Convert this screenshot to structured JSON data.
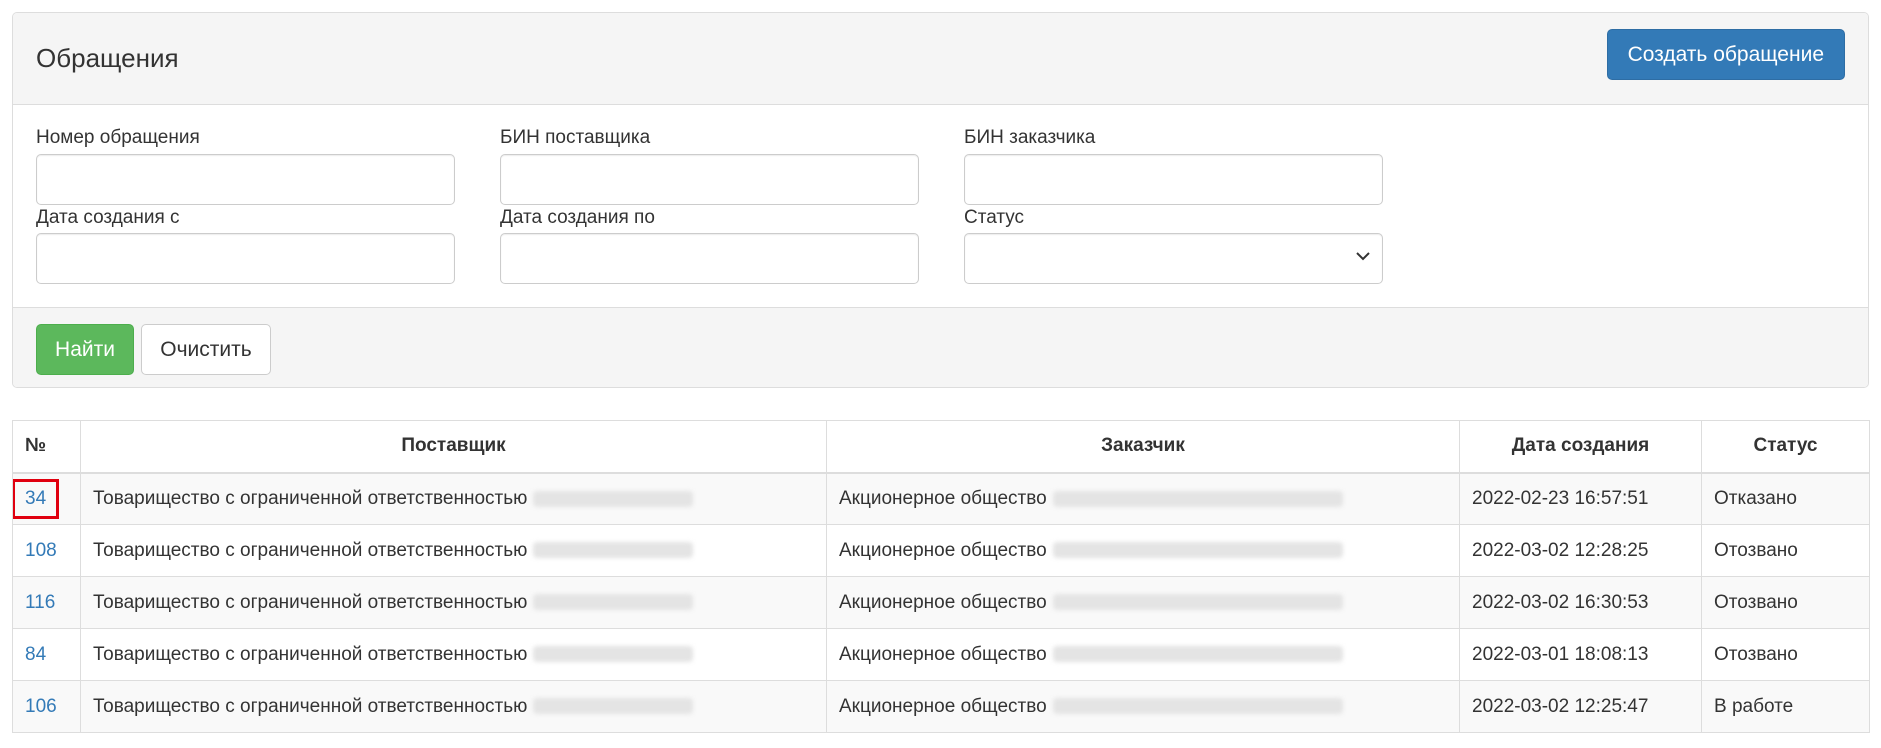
{
  "panel": {
    "title": "Обращения",
    "create_button": "Создать обращение"
  },
  "filters": {
    "number_label": "Номер обращения",
    "supplier_bin_label": "БИН поставщика",
    "customer_bin_label": "БИН заказчика",
    "date_from_label": "Дата создания с",
    "date_to_label": "Дата создания по",
    "status_label": "Статус",
    "number_value": "",
    "supplier_bin_value": "",
    "customer_bin_value": "",
    "date_from_value": "",
    "date_to_value": "",
    "status_value": ""
  },
  "actions": {
    "find_button": "Найти",
    "clear_button": "Очистить"
  },
  "table": {
    "headers": [
      "№",
      "Поставщик",
      "Заказчик",
      "Дата создания",
      "Статус"
    ],
    "rows": [
      {
        "number": "34",
        "supplier": "Товарищество с ограниченной ответственностью",
        "customer": "Акционерное общество",
        "date": "2022-02-23 16:57:51",
        "status": "Отказано"
      },
      {
        "number": "108",
        "supplier": "Товарищество с ограниченной ответственностью",
        "customer": "Акционерное общество",
        "date": "2022-03-02 12:28:25",
        "status": "Отозвано"
      },
      {
        "number": "116",
        "supplier": "Товарищество с ограниченной ответственностью",
        "customer": "Акционерное общество",
        "date": "2022-03-02 16:30:53",
        "status": "Отозвано"
      },
      {
        "number": "84",
        "supplier": "Товарищество с ограниченной ответственностью",
        "customer": "Акционерное общество",
        "date": "2022-03-01 18:08:13",
        "status": "Отозвано"
      },
      {
        "number": "106",
        "supplier": "Товарищество с ограниченной ответственностью",
        "customer": "Акционерное общество",
        "date": "2022-03-02 12:25:47",
        "status": "В работе"
      }
    ]
  },
  "colors": {
    "primary": "#337ab7",
    "success": "#5cb85c",
    "highlight_border": "#e0000f"
  }
}
